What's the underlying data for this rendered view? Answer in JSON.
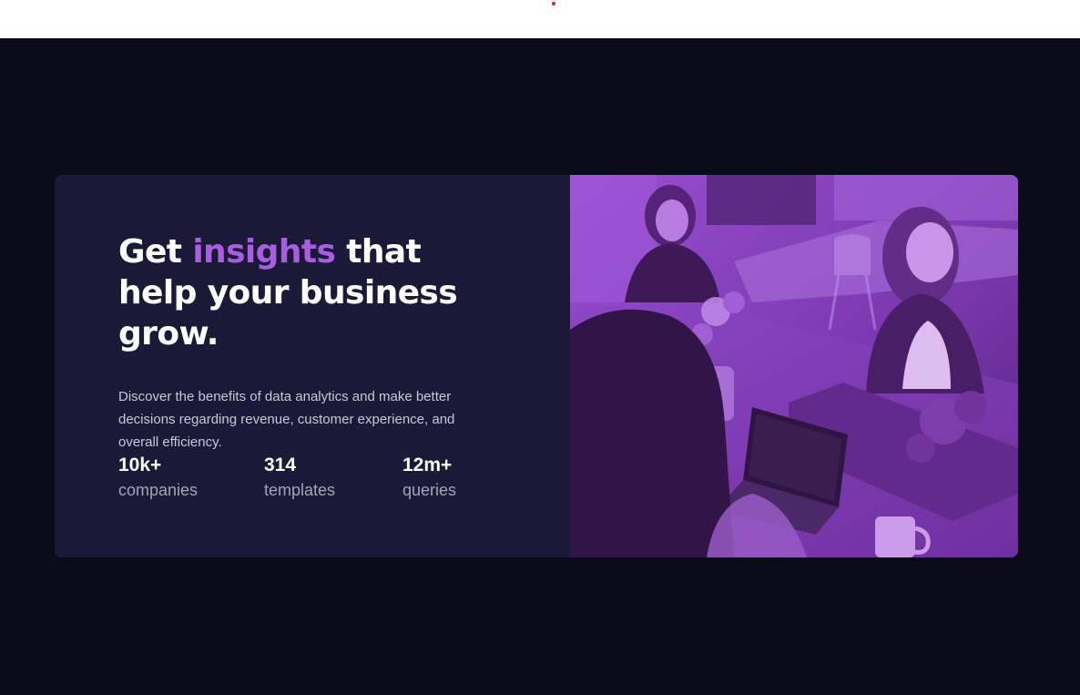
{
  "hero": {
    "headline_prefix": "Get ",
    "headline_accent": "insights",
    "headline_suffix": " that help your business grow.",
    "description": "Discover the benefits of data analytics and make better decisions regarding revenue, customer experience, and overall efficiency."
  },
  "stats": [
    {
      "value": "10k+",
      "label": "companies"
    },
    {
      "value": "314",
      "label": "templates"
    },
    {
      "value": "12m+",
      "label": "queries"
    }
  ],
  "colors": {
    "page_background": "#090b1a",
    "card_background": "#1b1938",
    "accent": "#a95ee0",
    "image_tint": "#8a3fc4",
    "heading": "#ffffff",
    "body_text": "#c9c8d6",
    "stat_label": "#a5a4b6"
  },
  "icons": {
    "loading_indicator": "red-dot-icon"
  }
}
